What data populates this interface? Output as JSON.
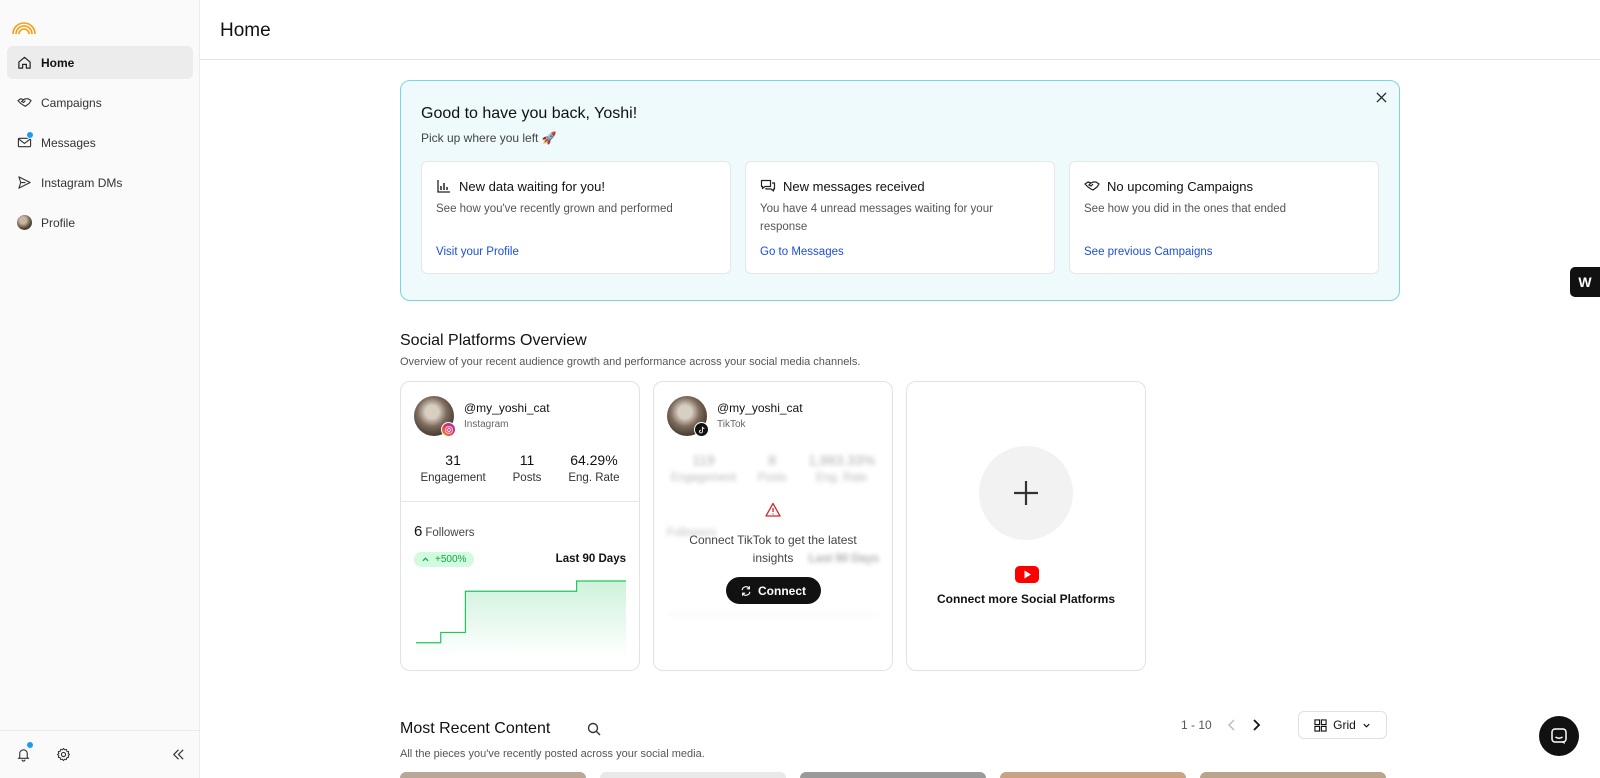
{
  "header": {
    "title": "Home"
  },
  "sidebar": {
    "items": [
      {
        "label": "Home",
        "icon": "home-icon"
      },
      {
        "label": "Campaigns",
        "icon": "handshake-icon"
      },
      {
        "label": "Messages",
        "icon": "mail-icon"
      },
      {
        "label": "Instagram DMs",
        "icon": "send-icon"
      },
      {
        "label": "Profile",
        "icon": "avatar"
      }
    ]
  },
  "banner": {
    "title": "Good to have you back, Yoshi!",
    "subtitle": "Pick up where you left 🚀",
    "cards": [
      {
        "title": "New data waiting for you!",
        "text": "See how you've recently grown and performed",
        "link": "Visit your Profile"
      },
      {
        "title": "New messages received",
        "text": "You have 4 unread messages waiting for your response",
        "link": "Go to Messages"
      },
      {
        "title": "No upcoming Campaigns",
        "text": "See how you did in the ones that ended",
        "link": "See previous Campaigns"
      }
    ]
  },
  "social": {
    "title": "Social Platforms Overview",
    "subtitle": "Overview of your recent audience growth and performance across your social media channels.",
    "instagram": {
      "handle": "@my_yoshi_cat",
      "platform": "Instagram",
      "stats": [
        {
          "value": "31",
          "label": "Engagement"
        },
        {
          "value": "11",
          "label": "Posts"
        },
        {
          "value": "64.29%",
          "label": "Eng. Rate"
        }
      ],
      "followers_count": "6",
      "followers_label": "Followers",
      "growth": "+500%",
      "period": "Last 90 Days",
      "sparkline": [
        1,
        1,
        2,
        2,
        6,
        6,
        6,
        6,
        6,
        6,
        6,
        6,
        6,
        7,
        7,
        7,
        7,
        7
      ]
    },
    "tiktok": {
      "handle": "@my_yoshi_cat",
      "platform": "TikTok",
      "stats": [
        {
          "value": "119",
          "label": "Engagement"
        },
        {
          "value": "8",
          "label": "Posts"
        },
        {
          "value": "1,983.33%",
          "label": "Eng. Rate"
        }
      ],
      "followers_label": "Followers",
      "period": "Last 90 Days",
      "message": "Connect TikTok to get the latest insights",
      "connect_label": "Connect"
    },
    "connect_more": "Connect more Social Platforms"
  },
  "recent": {
    "title": "Most Recent Content",
    "subtitle": "All the pieces you've recently posted across your social media.",
    "pagination": "1 - 10",
    "view": "Grid",
    "thumb_colors": [
      "#b9a89a",
      "#e9e9e9",
      "#9a9a9a",
      "#c9a383",
      "#b8a58c"
    ]
  },
  "colors": {
    "accent_link": "#1d4ed8",
    "banner_bg": "#eefafb",
    "banner_border": "#7dd3e0",
    "growth_bg": "#d1fadf",
    "growth_fg": "#16a34a",
    "notification_dot": "#1d9bf0"
  }
}
